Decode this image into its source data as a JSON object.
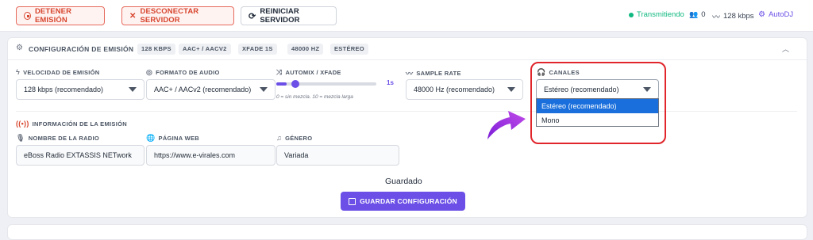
{
  "topbar": {
    "stop_label": "DETENER EMISIÓN",
    "disconnect_label": "DESCONECTAR SERVIDOR",
    "restart_label": "REINICIAR SERVIDOR",
    "status_text": "Transmitiendo",
    "listeners": "0",
    "bitrate": "128 kbps",
    "autodj": "AutoDJ"
  },
  "config": {
    "title": "CONFIGURACIÓN DE EMISIÓN",
    "badges": [
      "128 KBPS",
      "AAC+ / AACV2",
      "XFADE 1S",
      "48000 HZ",
      "ESTÉREO"
    ],
    "bitrate_label": "VELOCIDAD DE EMISIÓN",
    "bitrate_value": "128 kbps (recomendado)",
    "format_label": "FORMATO DE AUDIO",
    "format_value": "AAC+ / AACv2 (recomendado)",
    "automix_label": "AUTOMIX / XFADE",
    "automix_value": "1s",
    "automix_level": 1,
    "automix_max": 10,
    "automix_hint": "0 = sin mezcla. 10 = mezcla larga",
    "samplerate_label": "SAMPLE RATE",
    "samplerate_value": "48000 Hz (recomendado)",
    "channels_label": "CANALES",
    "channels_value": "Estéreo (recomendado)",
    "channels_options": [
      "Estéreo (recomendado)",
      "Mono"
    ]
  },
  "info": {
    "section_label": "INFORMACIÓN DE LA EMISIÓN",
    "name_label": "NOMBRE DE LA RADIO",
    "name_value": "eBoss Radio EXTASSIS NETwork",
    "web_label": "PÁGINA WEB",
    "web_value": "https://www.e-virales.com",
    "genre_label": "GÉNERO",
    "genre_value": "Variada"
  },
  "footer": {
    "saved_text": "Guardado",
    "save_label": "GUARDAR CONFIGURACIÓN"
  },
  "colors": {
    "accent": "#6b4fe6",
    "danger": "#d7462f",
    "live": "#10b981",
    "highlight": "#e0252b"
  }
}
